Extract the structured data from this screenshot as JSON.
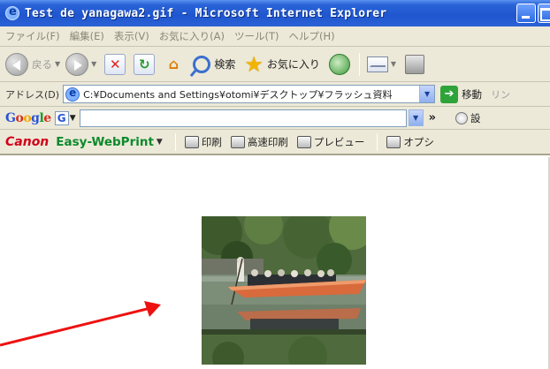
{
  "window": {
    "title": "Test de yanagawa2.gif - Microsoft Internet Explorer"
  },
  "menu": [
    "ファイル(F)",
    "編集(E)",
    "表示(V)",
    "お気に入り(A)",
    "ツール(T)",
    "ヘルプ(H)"
  ],
  "toolbar": {
    "back_label": "戻る",
    "search_label": "検索",
    "favorites_label": "お気に入り"
  },
  "address": {
    "label": "アドレス(D)",
    "value": "C:¥Documents and Settings¥otomi¥デスクトップ¥フラッシュ資料",
    "go_label": "移動",
    "links_label": "リン"
  },
  "google": {
    "logo": [
      "G",
      "o",
      "o",
      "g",
      "l",
      "e"
    ],
    "g_button": "G",
    "chevron": "»",
    "settings_label": "設"
  },
  "canon": {
    "brand": "Canon",
    "product": "Easy-WebPrint",
    "print_label": "印刷",
    "fast_print_label": "高速印刷",
    "preview_label": "プレビュー",
    "options_label": "オプシ"
  },
  "colors": {
    "titlebar": "#1f56cf",
    "chrome": "#ece9d8",
    "canon_red": "#d2001a",
    "easy_green": "#0c8a2c",
    "annotation_arrow": "#ee1111"
  }
}
